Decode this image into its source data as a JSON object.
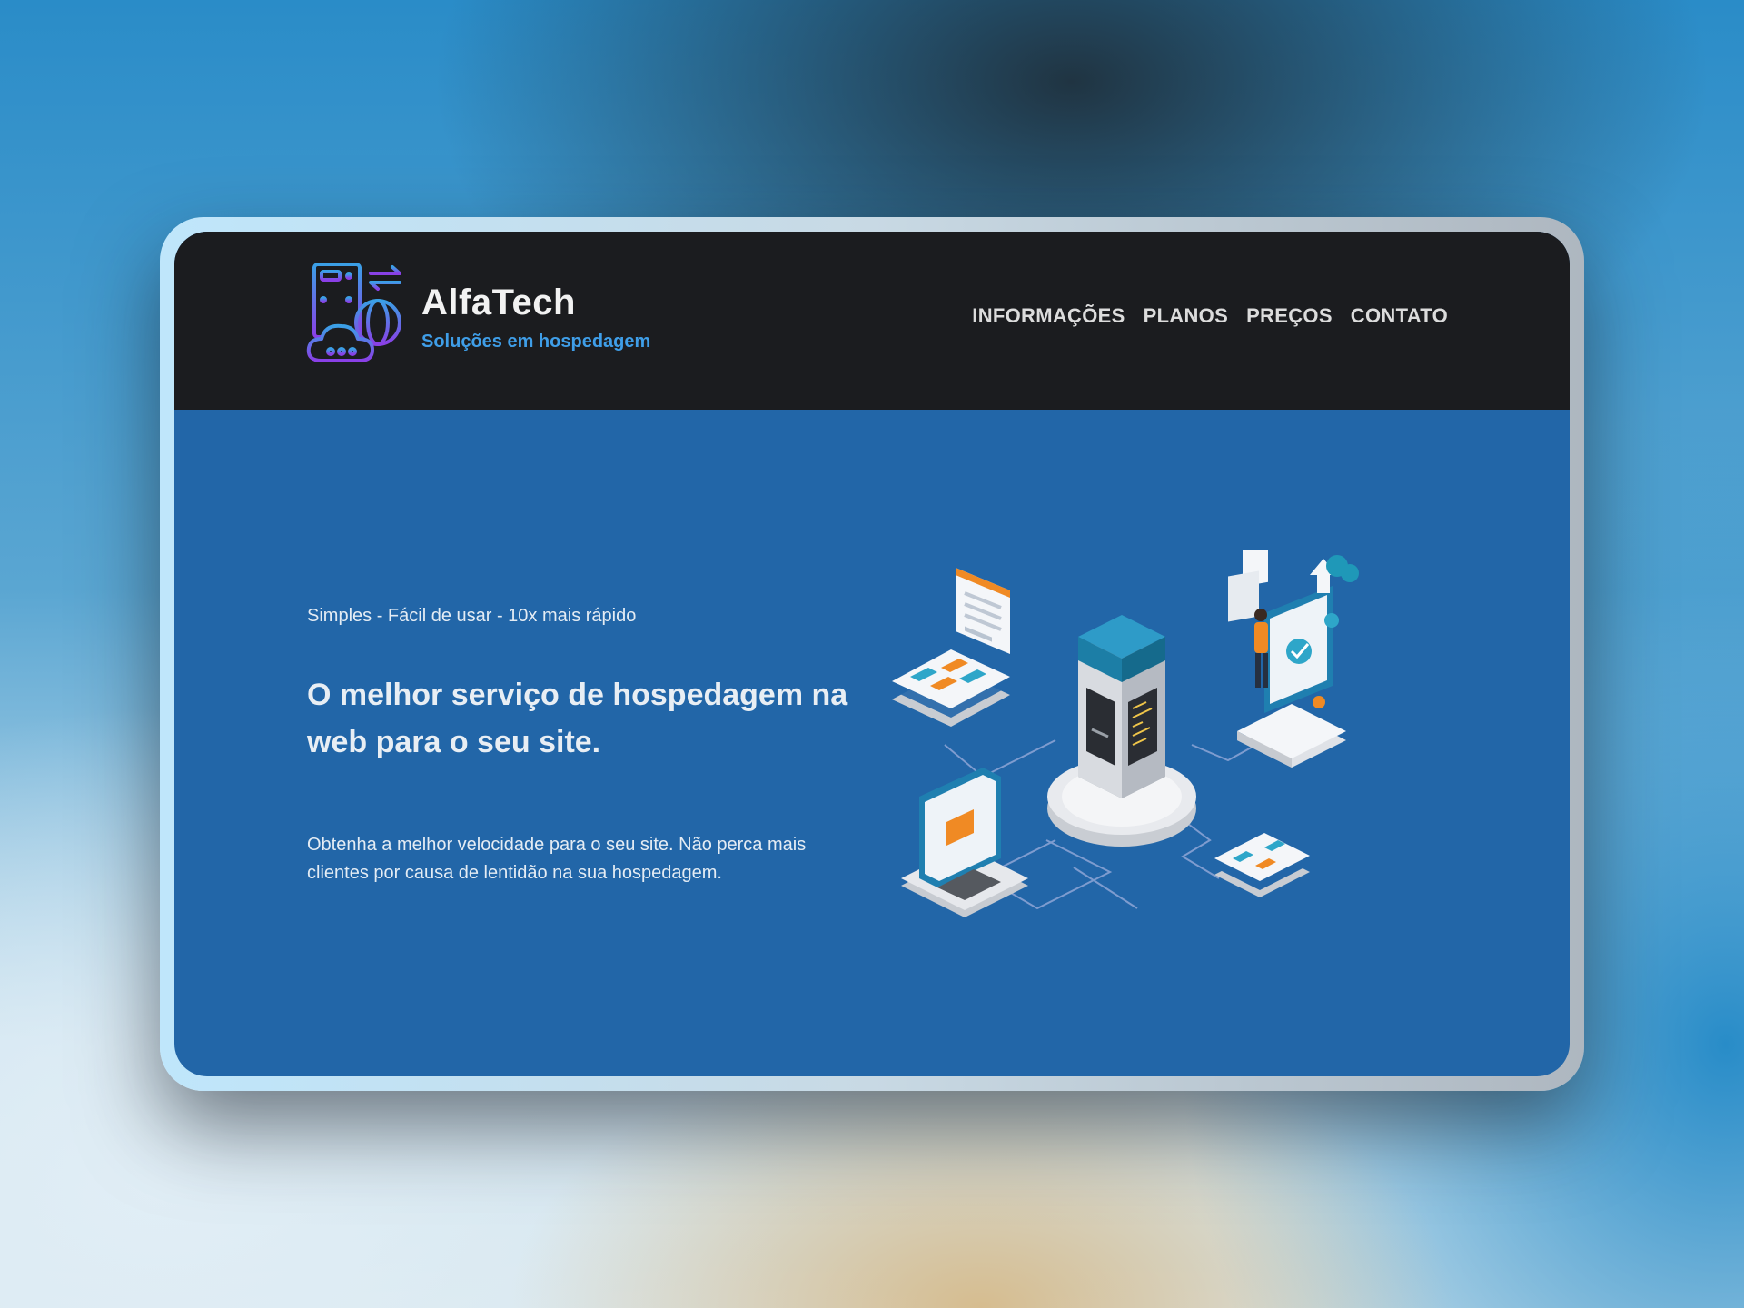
{
  "header": {
    "brand": "AlfaTech",
    "tagline": "Soluções em hospedagem",
    "logo_icon": "server-cloud-globe-icon"
  },
  "nav": {
    "items": [
      {
        "label": "INFORMAÇÕES"
      },
      {
        "label": "PLANOS"
      },
      {
        "label": "PREÇOS"
      },
      {
        "label": "CONTATO"
      }
    ]
  },
  "hero": {
    "subtitle": "Simples - Fácil de usar - 10x mais rápido",
    "title": "O melhor serviço de hospedagem na web para o seu site.",
    "description": "Obtenha a melhor velocidade para o seu site. Não perca mais clientes por causa de lentidão na sua hospedagem.",
    "illustration": "isometric-server-network-illustration"
  },
  "colors": {
    "header_bg": "#1b1c1f",
    "hero_bg": "#2266a8",
    "tagline": "#3f9ee8",
    "logo_gradient_start": "#3aa0e6",
    "logo_gradient_end": "#8a3fe6"
  }
}
